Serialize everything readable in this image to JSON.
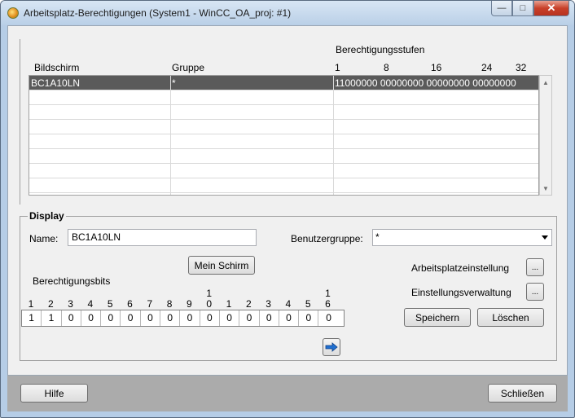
{
  "window": {
    "title": "Arbeitsplatz-Berechtigungen (System1 - WinCC_OA_proj: #1)",
    "minimize_glyph": "—",
    "maximize_glyph": "□",
    "close_glyph": "✕"
  },
  "table": {
    "headers": {
      "bildschirm": "Bildschirm",
      "gruppe": "Gruppe",
      "stufen_title": "Berechtigungsstufen",
      "stufen_ticks": [
        "1",
        "8",
        "16",
        "24",
        "32"
      ]
    },
    "rows": [
      {
        "bildschirm": "BC1A10LN",
        "gruppe": "*",
        "stufen": "11000000 00000000 00000000 00000000",
        "selected": true
      },
      {
        "bildschirm": "",
        "gruppe": "",
        "stufen": ""
      },
      {
        "bildschirm": "",
        "gruppe": "",
        "stufen": ""
      },
      {
        "bildschirm": "",
        "gruppe": "",
        "stufen": ""
      },
      {
        "bildschirm": "",
        "gruppe": "",
        "stufen": ""
      },
      {
        "bildschirm": "",
        "gruppe": "",
        "stufen": ""
      },
      {
        "bildschirm": "",
        "gruppe": "",
        "stufen": ""
      },
      {
        "bildschirm": "",
        "gruppe": "",
        "stufen": ""
      }
    ],
    "scroll_up_glyph": "▲",
    "scroll_down_glyph": "▼"
  },
  "display": {
    "group_title": "Display",
    "name_label": "Name:",
    "name_value": "BC1A10LN",
    "benutzergruppe_label": "Benutzergruppe:",
    "benutzergruppe_value": "*",
    "mein_schirm_button": "Mein Schirm",
    "bits_label": "Berechtigungsbits",
    "bit_numbers_top": [
      "",
      "",
      "",
      "",
      "",
      "",
      "",
      "",
      "",
      "1",
      "",
      "",
      "",
      "",
      "",
      "1"
    ],
    "bit_numbers_bottom": [
      "1",
      "2",
      "3",
      "4",
      "5",
      "6",
      "7",
      "8",
      "9",
      "0",
      "1",
      "2",
      "3",
      "4",
      "5",
      "6"
    ],
    "bit_values": [
      "1",
      "1",
      "0",
      "0",
      "0",
      "0",
      "0",
      "0",
      "0",
      "0",
      "0",
      "0",
      "0",
      "0",
      "0",
      "0"
    ],
    "arbeitsplatz_label": "Arbeitsplatzeinstellung",
    "einstellung_label": "Einstellungsverwaltung",
    "ellipsis": "...",
    "speichern_button": "Speichern",
    "loeschen_button": "Löschen",
    "arrow_icon": "arrow-right-icon",
    "arrow_color": "#1f6fd0"
  },
  "footer": {
    "hilfe_button": "Hilfe",
    "schliessen_button": "Schließen"
  }
}
